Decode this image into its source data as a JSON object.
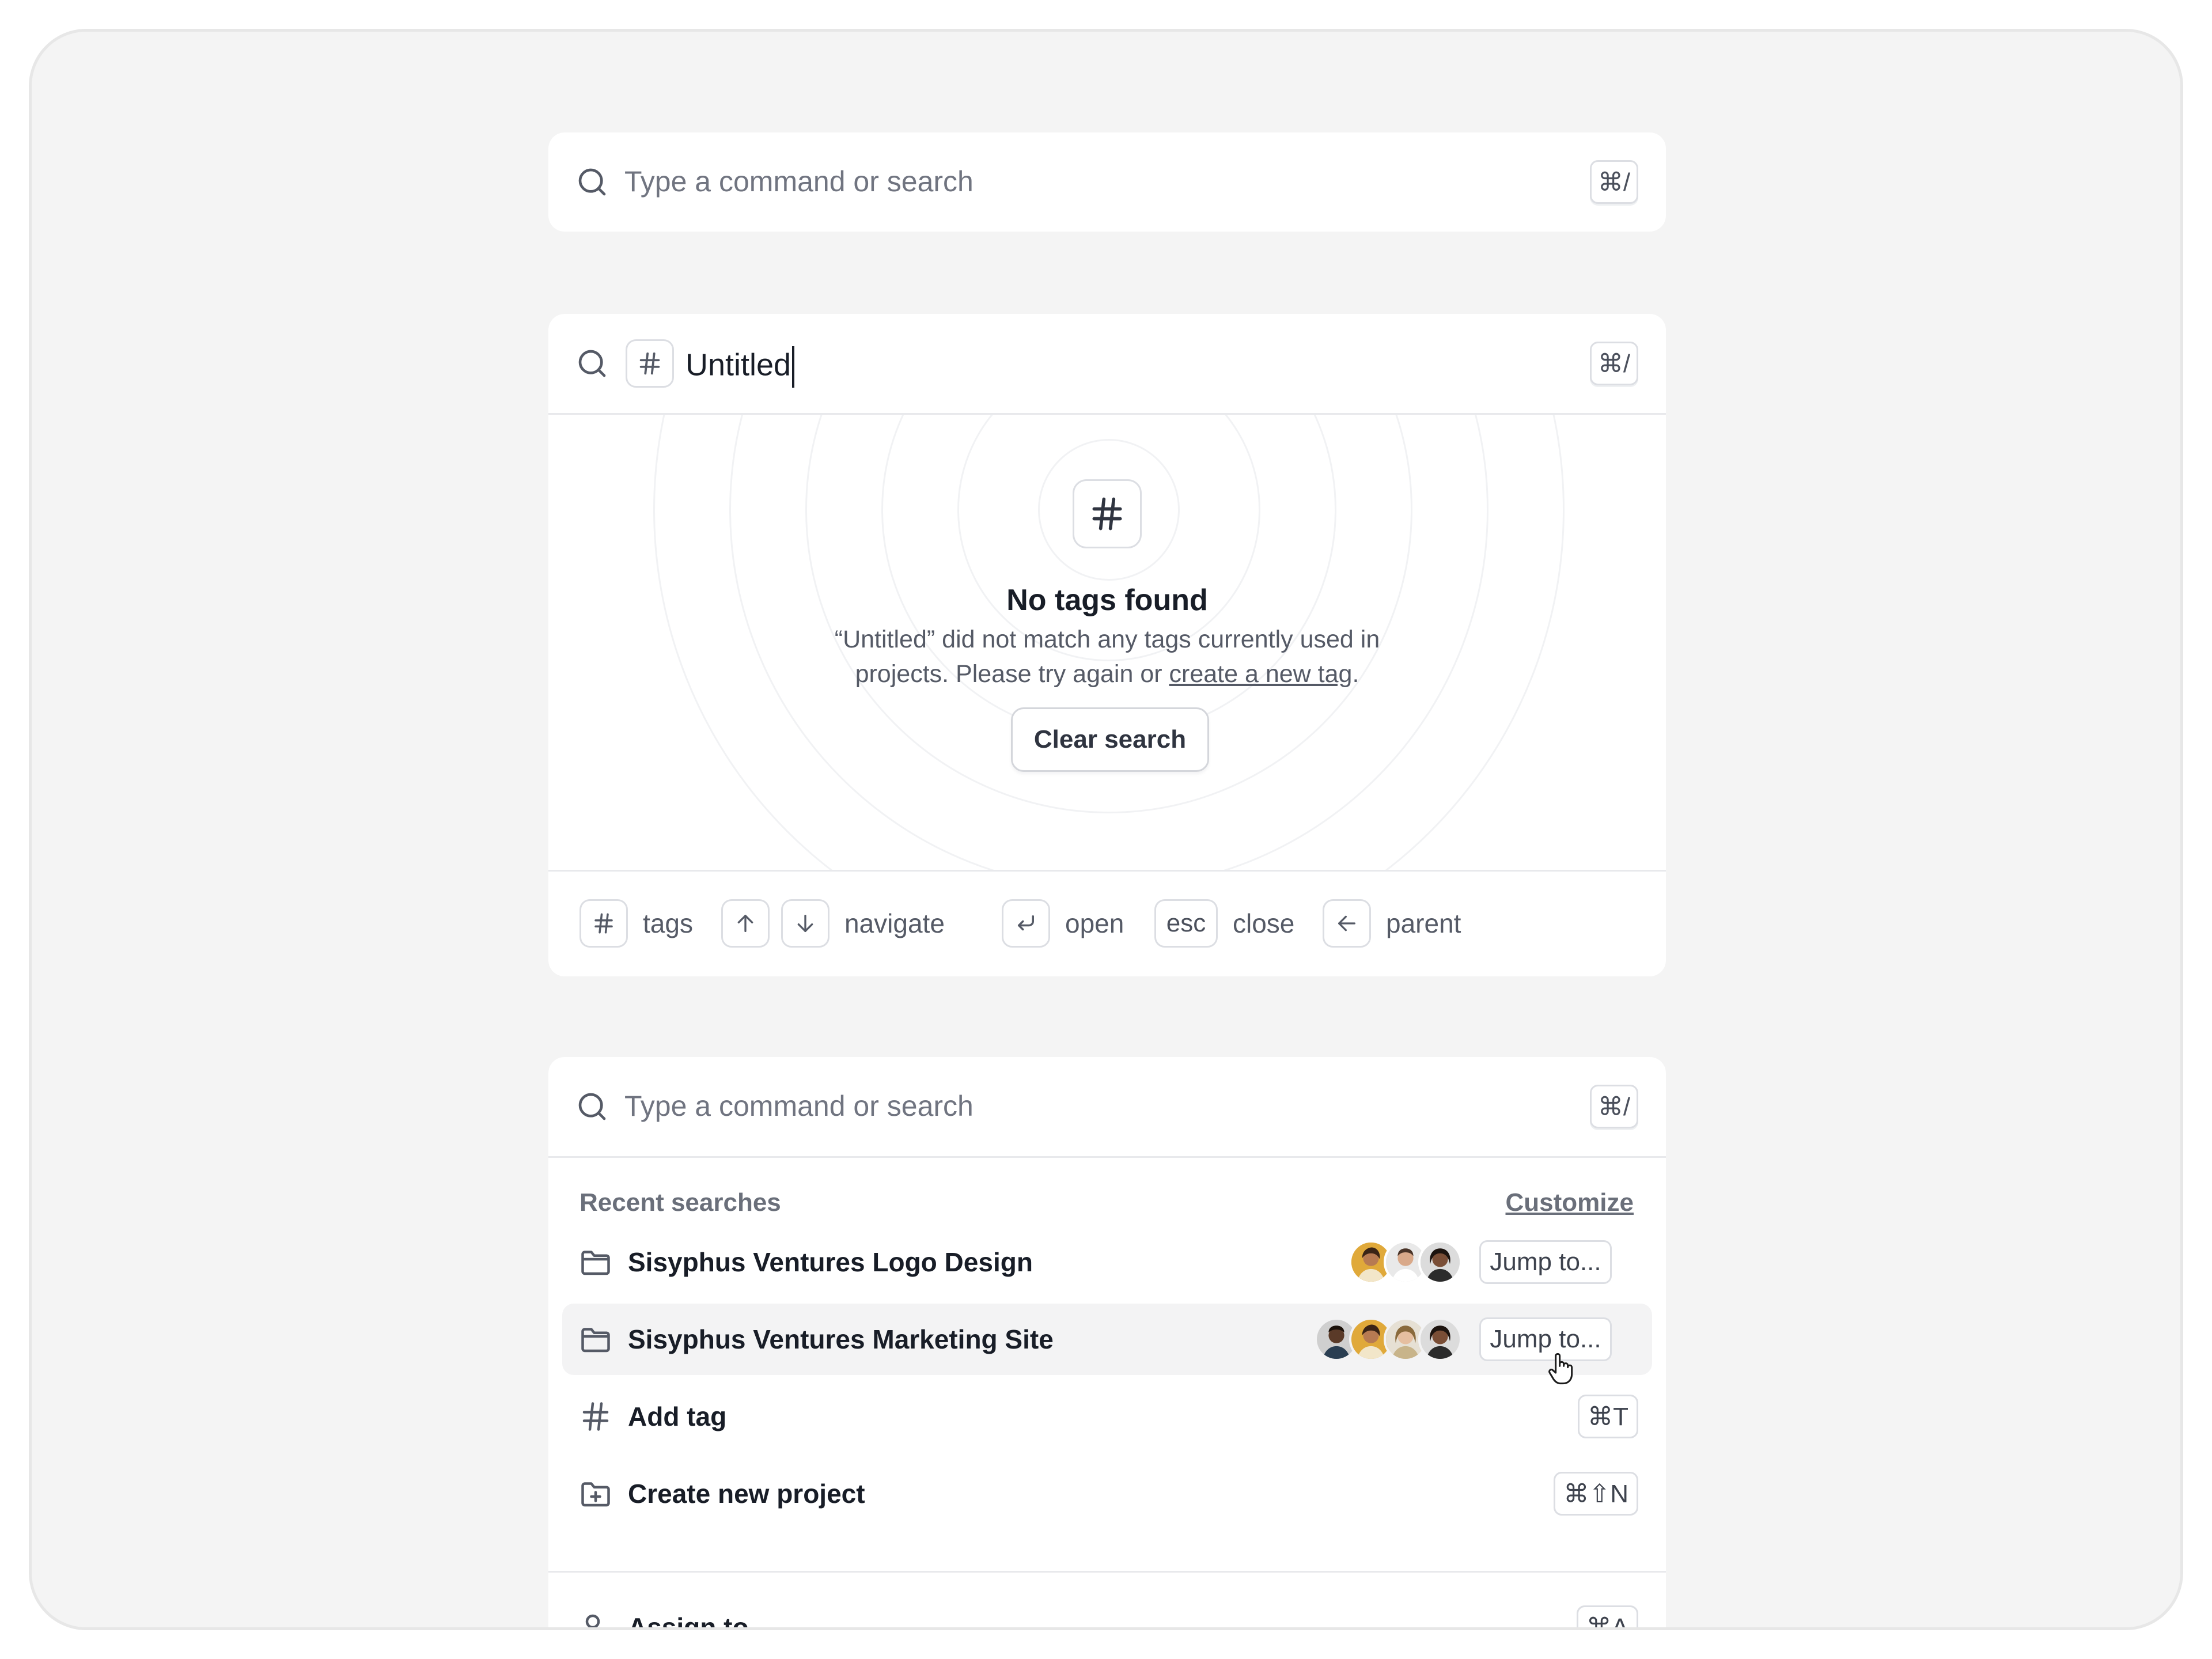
{
  "panel1": {
    "placeholder": "Type a command or search",
    "shortcut": "⌘/"
  },
  "panel2": {
    "query": "Untitled",
    "shortcut": "⌘/",
    "empty_title": "No tags found",
    "empty_desc_before": "“Untitled” did not match any tags currently used in projects. Please try again or ",
    "empty_desc_link": "create a new tag",
    "empty_desc_after": ".",
    "clear_button": "Clear search",
    "footer": {
      "tags_label": "tags",
      "navigate_label": "navigate",
      "open_label": "open",
      "esc_key": "esc",
      "close_label": "close",
      "parent_label": "parent"
    }
  },
  "panel3": {
    "placeholder": "Type a command or search",
    "shortcut": "⌘/",
    "section_label": "Recent searches",
    "customize": "Customize",
    "items": [
      {
        "label": "Sisyphus Ventures Logo Design",
        "action": "Jump to...",
        "icon": "folder-icon"
      },
      {
        "label": "Sisyphus Ventures Marketing Site",
        "action": "Jump to...",
        "icon": "folder-icon"
      },
      {
        "label": "Add tag",
        "shortcut": "⌘T",
        "icon": "hash-icon"
      },
      {
        "label": "Create new project",
        "shortcut": "⌘⇧N",
        "icon": "folder-plus-icon"
      },
      {
        "label": "Assign to...",
        "shortcut": "⌘A",
        "icon": "user-plus-icon"
      }
    ]
  },
  "colors": {
    "background": "#f4f4f4",
    "panel": "#ffffff",
    "text": "#181d27",
    "muted": "#555a66",
    "border": "#dcdee3",
    "hover_row": "#f3f3f4"
  }
}
